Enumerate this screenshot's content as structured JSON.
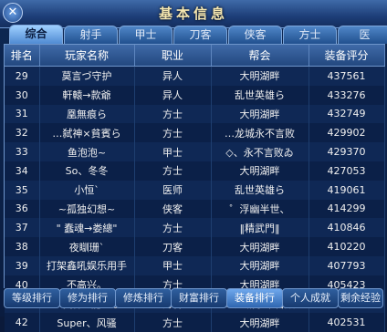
{
  "window": {
    "title": "基本信息",
    "close_label": "✕"
  },
  "tabs": [
    "综合",
    "射手",
    "甲士",
    "刀客",
    "侠客",
    "方士",
    "医"
  ],
  "active_tab": 0,
  "table": {
    "headers": [
      "排名",
      "玩家名称",
      "职业",
      "帮会",
      "装备评分"
    ],
    "rows": [
      [
        "29",
        "莫言づ守护",
        "异人",
        "大明湖畔",
        "437561"
      ],
      [
        "30",
        "軒轅→款爺",
        "异人",
        "乱世英雄ら",
        "433276"
      ],
      [
        "31",
        "凰無痕ら",
        "方士",
        "大明湖畔",
        "432749"
      ],
      [
        "32",
        "…弑神×貧賓ら",
        "方士",
        "…龙城永不言败",
        "429902"
      ],
      [
        "33",
        "鱼泡泡~",
        "甲士",
        "◇、永不言败ゐ",
        "429370"
      ],
      [
        "34",
        "So、冬冬",
        "方士",
        "大明湖畔",
        "427053"
      ],
      [
        "35",
        "小恒`",
        "医师",
        "乱世英雄ら",
        "419061"
      ],
      [
        "36",
        "~孤独幻想~",
        "侠客",
        "゜浮幽半世、",
        "414299"
      ],
      [
        "37",
        "\" 蠢魂→娄總\"",
        "方士",
        "‖精武門‖",
        "410846"
      ],
      [
        "38",
        "夜瞓珊`",
        "刀客",
        "大明湖畔",
        "410220"
      ],
      [
        "39",
        "打架鑫吼娱乐用手",
        "甲士",
        "大明湖畔",
        "407793"
      ],
      [
        "40",
        "不高兴。",
        "方士",
        "大明湖畔",
        "405423"
      ],
      [
        "41",
        "…弑神×龍恋ら",
        "刀客",
        "…龙城永不言败",
        "404340"
      ],
      [
        "42",
        "Super、风骚",
        "方士",
        "大明湖畔",
        "402531"
      ]
    ]
  },
  "bottom_tabs": [
    "等级排行",
    "修为排行",
    "修炼排行",
    "财富排行",
    "装备排行",
    "个人成就",
    "剩余经验"
  ],
  "active_bottom_tab": 4
}
